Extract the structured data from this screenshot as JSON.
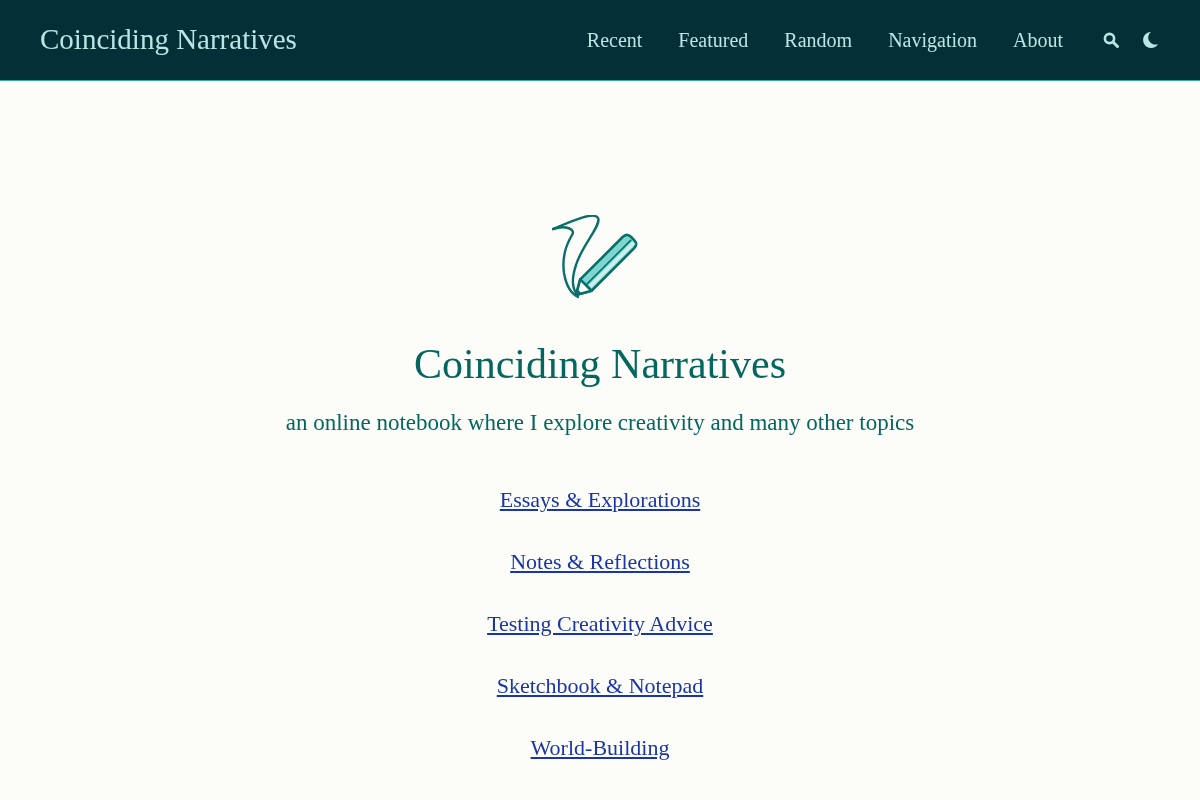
{
  "header": {
    "site_title": "Coinciding Narratives",
    "nav": [
      "Recent",
      "Featured",
      "Random",
      "Navigation",
      "About"
    ]
  },
  "hero": {
    "title": "Coinciding Narratives",
    "subtitle": "an online notebook where I explore creativity and many other topics"
  },
  "links": [
    "Essays & Explorations",
    "Notes & Reflections",
    "Testing Creativity Advice",
    "Sketchbook & Notepad",
    "World-Building"
  ]
}
